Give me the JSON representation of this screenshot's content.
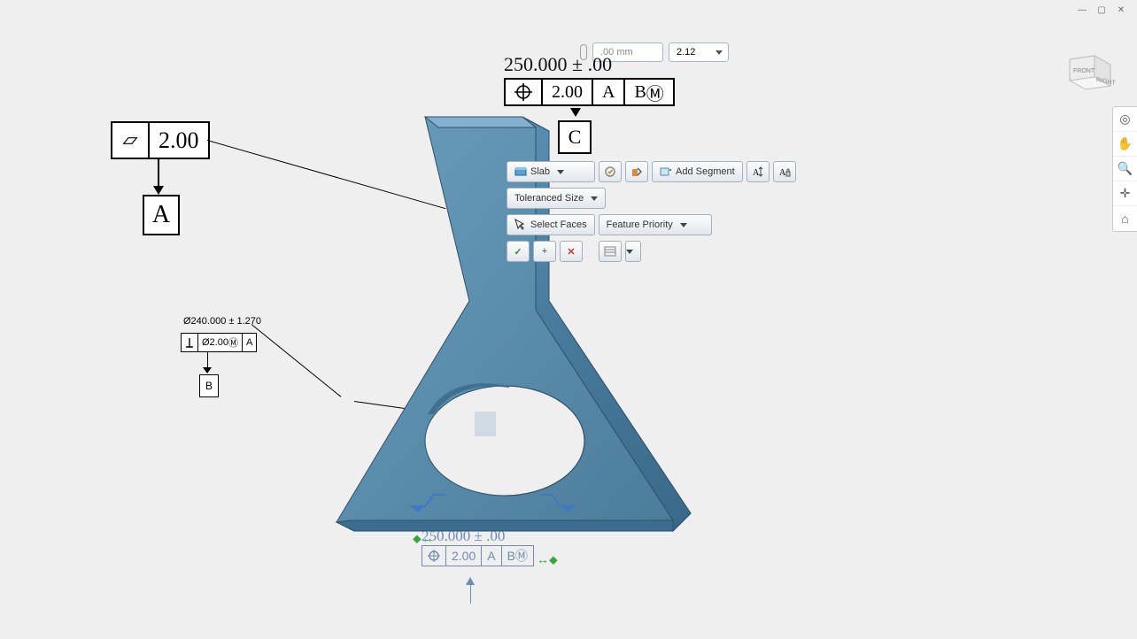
{
  "window_controls": {
    "minimize": "—",
    "maximize": "▢",
    "close": "✕"
  },
  "top_bar": {
    "unit_value": ".00 mm",
    "version": "2.12"
  },
  "main_dimension": "250.000 ± .00",
  "fcf_top": {
    "symbol": "position",
    "tol": "2.00",
    "d1": "A",
    "d2": "B",
    "mod": "Ⓜ"
  },
  "fcf_c_datum": "C",
  "fcf_left": {
    "symbol": "flatness",
    "tol": "2.00"
  },
  "datum_a": "A",
  "mid_anno": {
    "dim": "Ø240.000 ± 1.270",
    "perp_tol": "Ø2.00",
    "perp_mod": "Ⓜ",
    "perp_ref": "A"
  },
  "datum_b": "B",
  "ctx": {
    "slab": "Slab",
    "add_segment": "Add Segment",
    "toleranced_size": "Toleranced Size",
    "select_faces": "Select Faces",
    "feature_priority": "Feature Priority"
  },
  "bottom_dim": {
    "text": "250.000 ± .00",
    "tol": "2.00",
    "d1": "A",
    "d2": "B",
    "mod": "Ⓜ"
  },
  "tools": {
    "t1": "◎",
    "t2": "✋",
    "t3": "🔍",
    "t4": "✛",
    "t5": "⌂"
  },
  "viewcube": {
    "front": "FRONT",
    "right": "RIGHT"
  }
}
